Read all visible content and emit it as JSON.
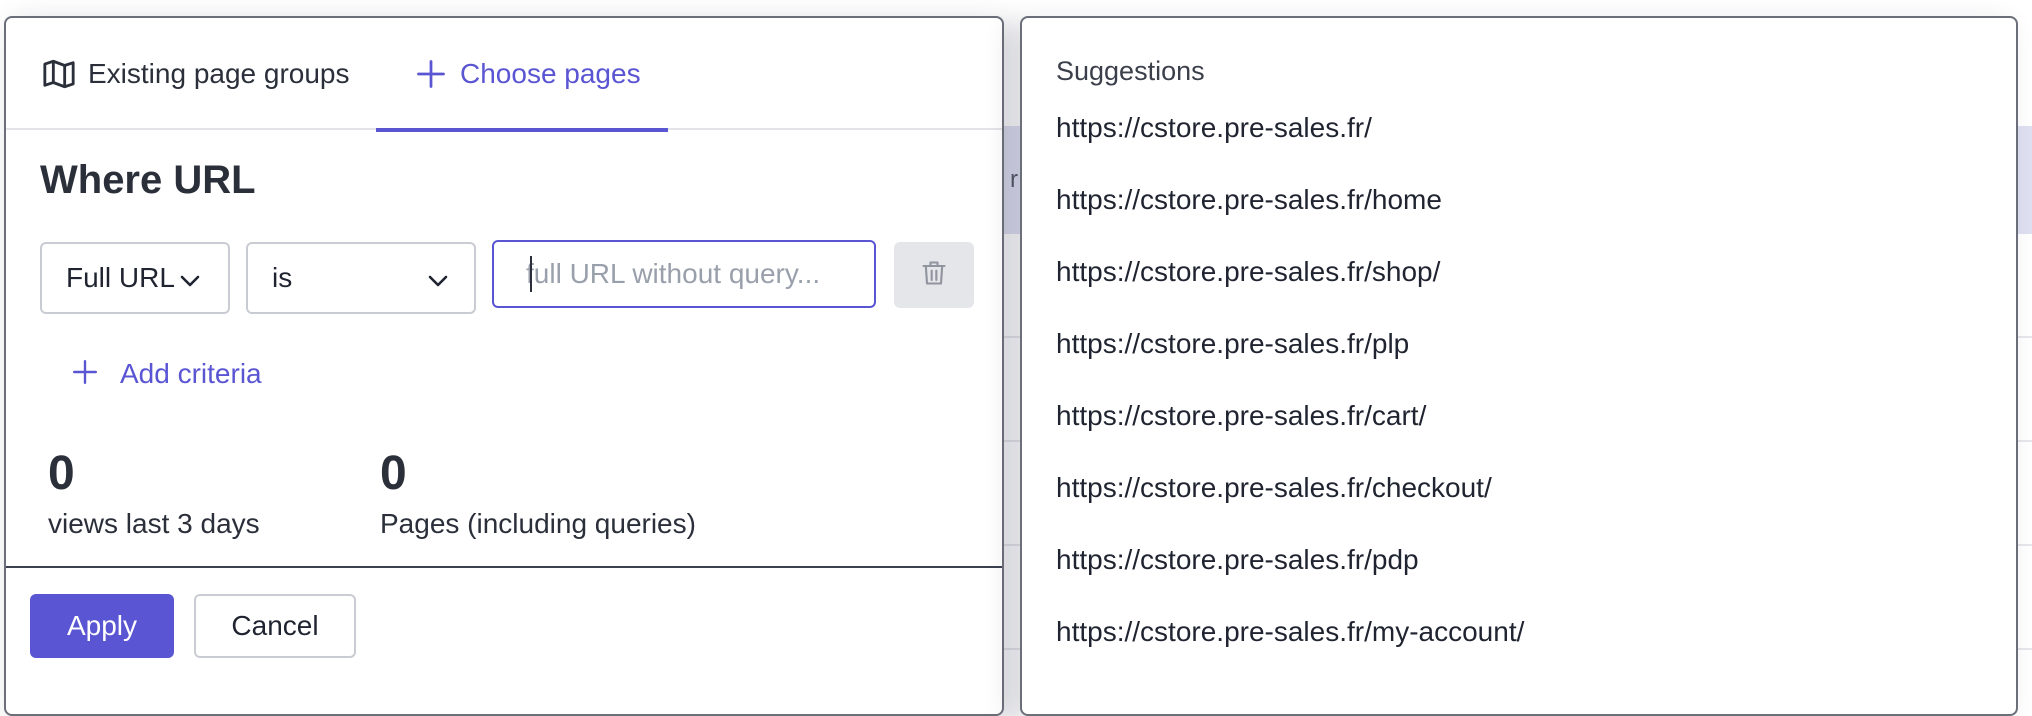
{
  "tabs": {
    "existing": {
      "label": "Existing page groups",
      "icon": "map-icon"
    },
    "choose": {
      "label": "Choose pages",
      "icon": "plus-icon",
      "active": true
    }
  },
  "criteria": {
    "title": "Where URL",
    "field_select": "Full URL",
    "operator_select": "is",
    "url_input": {
      "value": "",
      "placeholder": "full URL without query..."
    },
    "add_label": "Add criteria"
  },
  "stats": [
    {
      "value": "0",
      "label": "views last 3 days"
    },
    {
      "value": "0",
      "label": "Pages (including queries)"
    }
  ],
  "footer": {
    "apply_label": "Apply",
    "cancel_label": "Cancel"
  },
  "suggestions": {
    "title": "Suggestions",
    "items": [
      "https://cstore.pre-sales.fr/",
      "https://cstore.pre-sales.fr/home",
      "https://cstore.pre-sales.fr/shop/",
      "https://cstore.pre-sales.fr/plp",
      "https://cstore.pre-sales.fr/cart/",
      "https://cstore.pre-sales.fr/checkout/",
      "https://cstore.pre-sales.fr/pdp",
      "https://cstore.pre-sales.fr/my-account/"
    ]
  },
  "background": {
    "partial_glyph": "r"
  },
  "colors": {
    "accent": "#5a55d2",
    "text": "#2a2f3a",
    "border": "#c9ccd3",
    "disabled_bg": "#e5e6ea"
  }
}
